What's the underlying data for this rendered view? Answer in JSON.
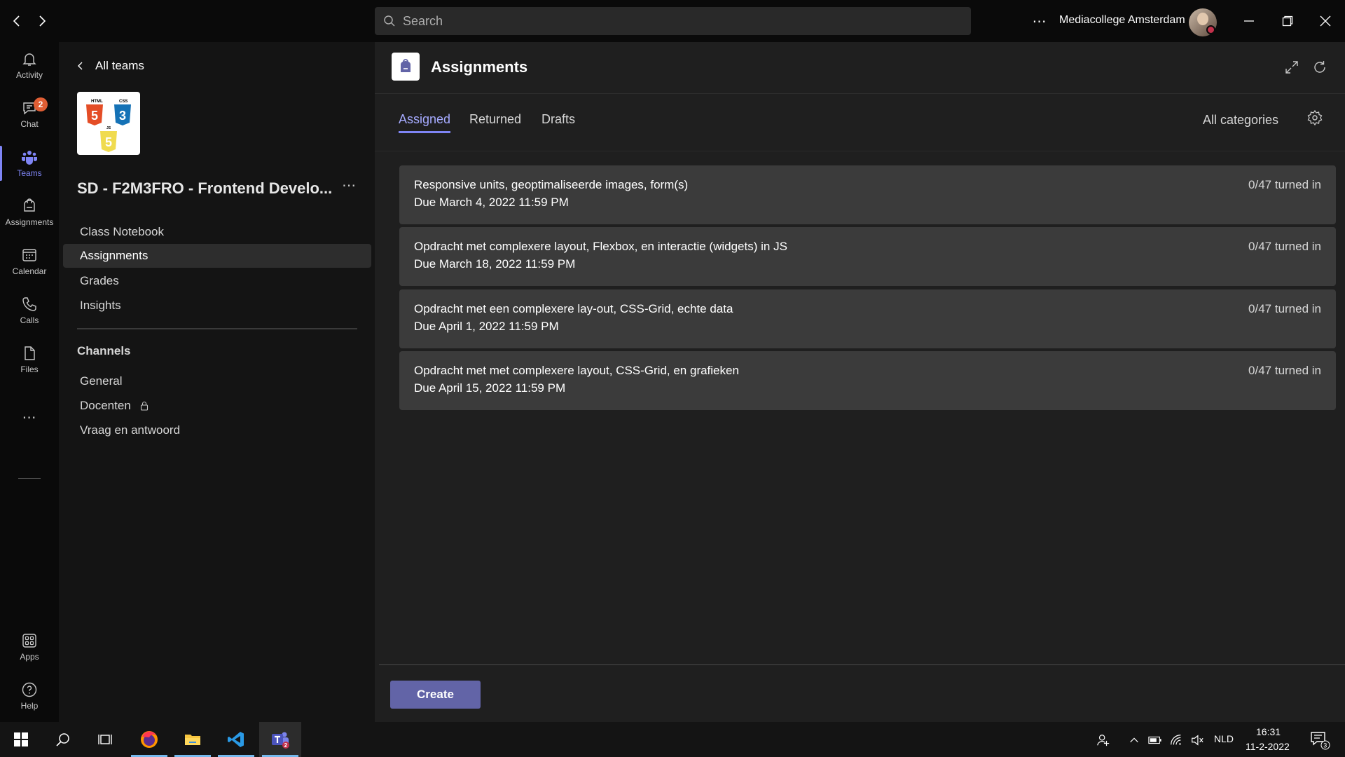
{
  "titlebar": {
    "search_placeholder": "Search",
    "more": "⋯",
    "org_name": "Mediacollege Amsterdam"
  },
  "rail": {
    "items": [
      {
        "label": "Activity",
        "icon": "bell-icon"
      },
      {
        "label": "Chat",
        "icon": "chat-icon",
        "badge": "2"
      },
      {
        "label": "Teams",
        "icon": "teams-icon",
        "active": true
      },
      {
        "label": "Assignments",
        "icon": "assignments-icon"
      },
      {
        "label": "Calendar",
        "icon": "calendar-icon"
      },
      {
        "label": "Calls",
        "icon": "phone-icon"
      },
      {
        "label": "Files",
        "icon": "file-icon"
      }
    ],
    "more": "⋯",
    "apps": "Apps",
    "help": "Help"
  },
  "panel": {
    "back_label": "All teams",
    "team_name": "SD - F2M3FRO - Frontend Develo...",
    "team_more": "⋯",
    "logo_labels": {
      "html": "HTML",
      "css": "CSS",
      "js": "JS"
    },
    "nav": [
      "Class Notebook",
      "Assignments",
      "Grades",
      "Insights"
    ],
    "channels_heading": "Channels",
    "channels": [
      "General",
      "Docenten",
      "Vraag en antwoord"
    ]
  },
  "main": {
    "title": "Assignments",
    "tabs": [
      "Assigned",
      "Returned",
      "Drafts"
    ],
    "categories": "All categories",
    "assignments": [
      {
        "title": "Responsive units, geoptimaliseerde images, form(s)",
        "due": "Due March 4, 2022 11:59 PM",
        "status": "0/47 turned in"
      },
      {
        "title": "Opdracht met complexere layout, Flexbox, en interactie (widgets) in JS",
        "due": "Due March 18, 2022 11:59 PM",
        "status": "0/47 turned in"
      },
      {
        "title": "Opdracht met een complexere lay-out, CSS-Grid, echte data",
        "due": "Due April 1, 2022 11:59 PM",
        "status": "0/47 turned in"
      },
      {
        "title": "Opdracht met met complexere layout, CSS-Grid, en grafieken",
        "due": "Due April 15, 2022 11:59 PM",
        "status": "0/47 turned in"
      }
    ],
    "create_label": "Create"
  },
  "taskbar": {
    "teams_badge": "2",
    "language": "NLD",
    "time": "16:31",
    "date": "11-2-2022",
    "notifications": "3"
  },
  "colors": {
    "accent": "#7f85f5",
    "button": "#6264a7",
    "badge": "#e05e34"
  }
}
